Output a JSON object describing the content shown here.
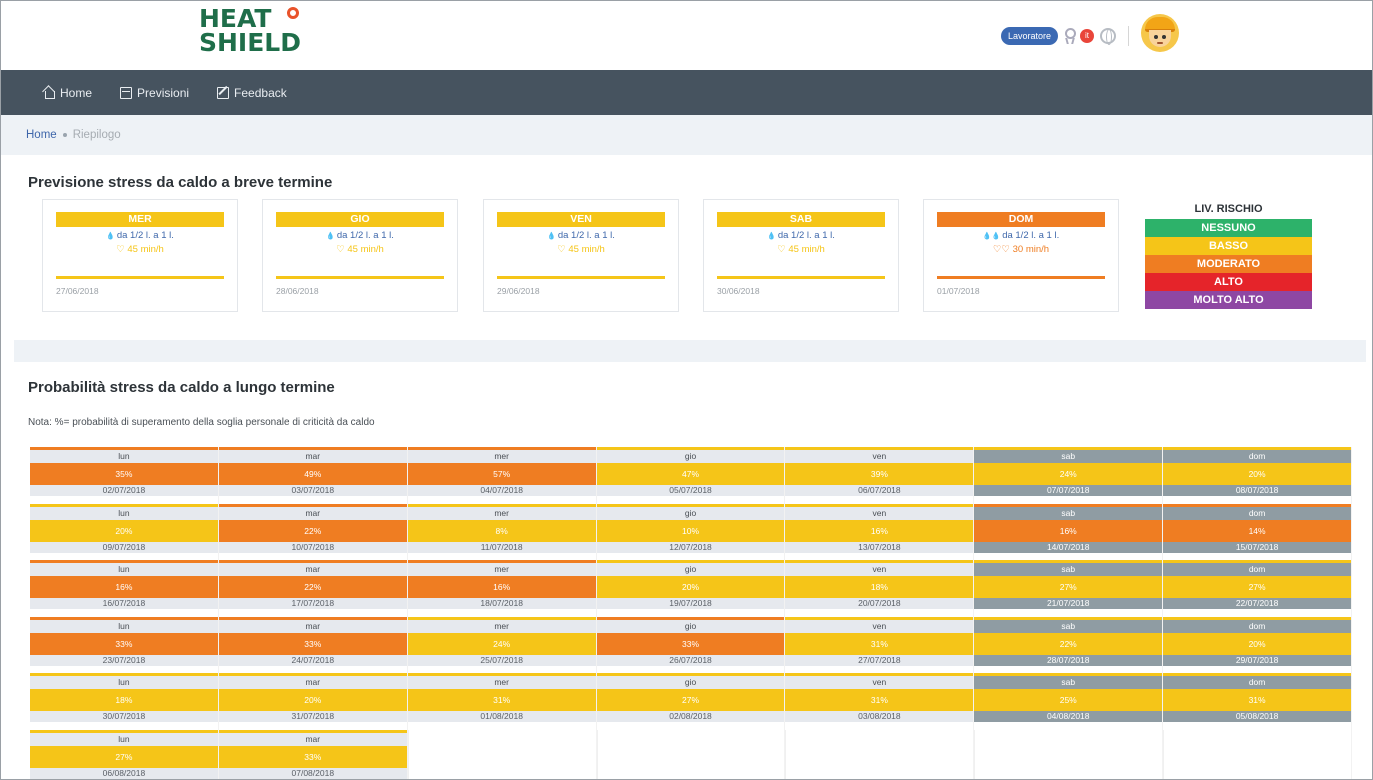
{
  "app": {
    "logo_line1": "HEAT",
    "logo_line2": "SHIELD"
  },
  "user": {
    "role_badge": "Lavoratore",
    "lang_flag": "it"
  },
  "nav": [
    {
      "label": "Home",
      "icon": "home-icon"
    },
    {
      "label": "Previsioni",
      "icon": "calendar-icon"
    },
    {
      "label": "Feedback",
      "icon": "edit-icon"
    }
  ],
  "breadcrumb": {
    "home": "Home",
    "current": "Riepilogo"
  },
  "short_term": {
    "title": "Previsione stress da caldo a breve termine",
    "cards": [
      {
        "day": "MER",
        "water": "da 1/2 l. a 1 l.",
        "time": "45 min/h",
        "date": "27/06/2018",
        "level": "BASSO",
        "color": "#f5c518"
      },
      {
        "day": "GIO",
        "water": "da 1/2 l. a 1 l.",
        "time": "45 min/h",
        "date": "28/06/2018",
        "level": "BASSO",
        "color": "#f5c518"
      },
      {
        "day": "VEN",
        "water": "da 1/2 l. a 1 l.",
        "time": "45 min/h",
        "date": "29/06/2018",
        "level": "BASSO",
        "color": "#f5c518"
      },
      {
        "day": "SAB",
        "water": "da 1/2 l. a 1 l.",
        "time": "45 min/h",
        "date": "30/06/2018",
        "level": "BASSO",
        "color": "#f5c518"
      },
      {
        "day": "DOM",
        "water": "da 1/2 l. a 1 l.",
        "time": "30 min/h",
        "date": "01/07/2018",
        "level": "MODERATO",
        "color": "#ef7d22"
      }
    ]
  },
  "legend": {
    "title": "LIV. RISCHIO",
    "items": [
      {
        "label": "NESSUNO",
        "color": "#2db26a"
      },
      {
        "label": "BASSO",
        "color": "#f5c518"
      },
      {
        "label": "MODERATO",
        "color": "#ef7d22"
      },
      {
        "label": "ALTO",
        "color": "#e5242a"
      },
      {
        "label": "MOLTO ALTO",
        "color": "#8e47a3"
      }
    ]
  },
  "long_term": {
    "title": "Probabilità stress da caldo a lungo termine",
    "note": "Nota: %= probabilità di superamento della soglia personale di criticità da caldo",
    "colors": {
      "yellow": "#f5c518",
      "orange": "#ef7d22"
    },
    "weeks": [
      [
        {
          "d": "lun",
          "p": "35%",
          "dt": "02/07/2018",
          "c": "orange"
        },
        {
          "d": "mar",
          "p": "49%",
          "dt": "03/07/2018",
          "c": "orange"
        },
        {
          "d": "mer",
          "p": "57%",
          "dt": "04/07/2018",
          "c": "orange"
        },
        {
          "d": "gio",
          "p": "47%",
          "dt": "05/07/2018",
          "c": "yellow"
        },
        {
          "d": "ven",
          "p": "39%",
          "dt": "06/07/2018",
          "c": "yellow"
        },
        {
          "d": "sab",
          "p": "24%",
          "dt": "07/07/2018",
          "c": "yellow",
          "w": true
        },
        {
          "d": "dom",
          "p": "20%",
          "dt": "08/07/2018",
          "c": "yellow",
          "w": true
        }
      ],
      [
        {
          "d": "lun",
          "p": "20%",
          "dt": "09/07/2018",
          "c": "yellow"
        },
        {
          "d": "mar",
          "p": "22%",
          "dt": "10/07/2018",
          "c": "orange"
        },
        {
          "d": "mer",
          "p": "8%",
          "dt": "11/07/2018",
          "c": "yellow"
        },
        {
          "d": "gio",
          "p": "10%",
          "dt": "12/07/2018",
          "c": "yellow"
        },
        {
          "d": "ven",
          "p": "16%",
          "dt": "13/07/2018",
          "c": "yellow"
        },
        {
          "d": "sab",
          "p": "16%",
          "dt": "14/07/2018",
          "c": "orange",
          "w": true
        },
        {
          "d": "dom",
          "p": "14%",
          "dt": "15/07/2018",
          "c": "orange",
          "w": true
        }
      ],
      [
        {
          "d": "lun",
          "p": "16%",
          "dt": "16/07/2018",
          "c": "orange"
        },
        {
          "d": "mar",
          "p": "22%",
          "dt": "17/07/2018",
          "c": "orange"
        },
        {
          "d": "mer",
          "p": "16%",
          "dt": "18/07/2018",
          "c": "orange"
        },
        {
          "d": "gio",
          "p": "20%",
          "dt": "19/07/2018",
          "c": "yellow"
        },
        {
          "d": "ven",
          "p": "18%",
          "dt": "20/07/2018",
          "c": "yellow"
        },
        {
          "d": "sab",
          "p": "27%",
          "dt": "21/07/2018",
          "c": "yellow",
          "w": true
        },
        {
          "d": "dom",
          "p": "27%",
          "dt": "22/07/2018",
          "c": "yellow",
          "w": true
        }
      ],
      [
        {
          "d": "lun",
          "p": "33%",
          "dt": "23/07/2018",
          "c": "orange"
        },
        {
          "d": "mar",
          "p": "33%",
          "dt": "24/07/2018",
          "c": "orange"
        },
        {
          "d": "mer",
          "p": "24%",
          "dt": "25/07/2018",
          "c": "yellow"
        },
        {
          "d": "gio",
          "p": "33%",
          "dt": "26/07/2018",
          "c": "orange"
        },
        {
          "d": "ven",
          "p": "31%",
          "dt": "27/07/2018",
          "c": "yellow"
        },
        {
          "d": "sab",
          "p": "22%",
          "dt": "28/07/2018",
          "c": "yellow",
          "w": true
        },
        {
          "d": "dom",
          "p": "20%",
          "dt": "29/07/2018",
          "c": "yellow",
          "w": true
        }
      ],
      [
        {
          "d": "lun",
          "p": "18%",
          "dt": "30/07/2018",
          "c": "yellow"
        },
        {
          "d": "mar",
          "p": "20%",
          "dt": "31/07/2018",
          "c": "yellow"
        },
        {
          "d": "mer",
          "p": "31%",
          "dt": "01/08/2018",
          "c": "yellow"
        },
        {
          "d": "gio",
          "p": "27%",
          "dt": "02/08/2018",
          "c": "yellow"
        },
        {
          "d": "ven",
          "p": "31%",
          "dt": "03/08/2018",
          "c": "yellow"
        },
        {
          "d": "sab",
          "p": "25%",
          "dt": "04/08/2018",
          "c": "yellow",
          "w": true
        },
        {
          "d": "dom",
          "p": "31%",
          "dt": "05/08/2018",
          "c": "yellow",
          "w": true
        }
      ],
      [
        {
          "d": "lun",
          "p": "27%",
          "dt": "06/08/2018",
          "c": "yellow"
        },
        {
          "d": "mar",
          "p": "33%",
          "dt": "07/08/2018",
          "c": "yellow"
        }
      ]
    ]
  }
}
